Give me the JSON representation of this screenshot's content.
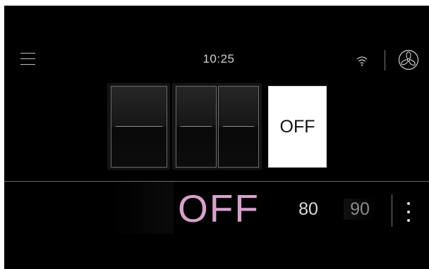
{
  "status_bar": {
    "menu_icon": "hamburger-menu-icon",
    "time": "10:25",
    "wifi_icon": "wifi-icon",
    "fan_icon": "fan-icon"
  },
  "selector": {
    "panels": [
      "—",
      "—",
      "—"
    ],
    "active_label": "OFF"
  },
  "mode_strip": {
    "active": "OFF",
    "options": [
      "80",
      "90"
    ],
    "more_icon": "more-vertical-icon"
  },
  "colors": {
    "background": "#000000",
    "accent": "#d6a2cc",
    "text": "#d8d8d8"
  }
}
